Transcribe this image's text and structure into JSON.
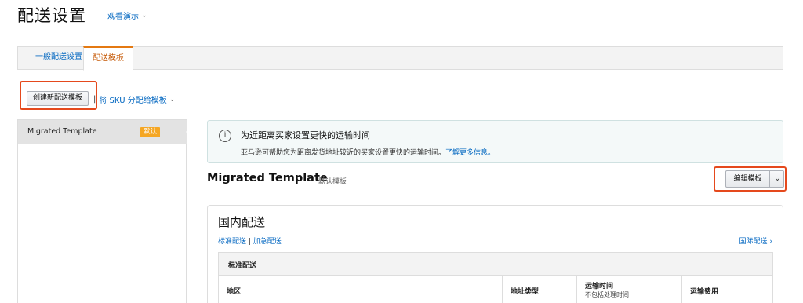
{
  "header": {
    "title": "配送设置",
    "demo_link": "观看演示"
  },
  "tabs": [
    {
      "label": "一般配送设置",
      "active": false
    },
    {
      "label": "配送模板",
      "active": true
    }
  ],
  "toolbar": {
    "create_button": "创建新配送模板",
    "assign_sku_link": "将 SKU 分配给模板"
  },
  "sidebar": {
    "items": [
      {
        "name": "Migrated Template",
        "badge": "默认",
        "selected": true
      }
    ]
  },
  "info": {
    "title": "为近距离买家设置更快的运输时间",
    "body": "亚马逊可帮助您为距离发货地址较近的买家设置更快的运输时间。",
    "link": "了解更多信息。"
  },
  "template": {
    "name": "Migrated Template",
    "subtitle": "默认模板",
    "edit_button": "编辑模板"
  },
  "domestic": {
    "title": "国内配送",
    "link_standard": "标准配送",
    "link_expedited": "加急配送",
    "intl_link": "国际配送 ›",
    "table_title": "标准配送",
    "columns": {
      "region": "地区",
      "address_type": "地址类型",
      "transit_time": "运输时间",
      "transit_note": "不包括处理时间",
      "shipping_fee": "运输费用"
    }
  },
  "colors": {
    "link": "#0066c0",
    "active_tab": "#c45500",
    "highlight": "#e5491d",
    "badge": "#f5a623"
  }
}
